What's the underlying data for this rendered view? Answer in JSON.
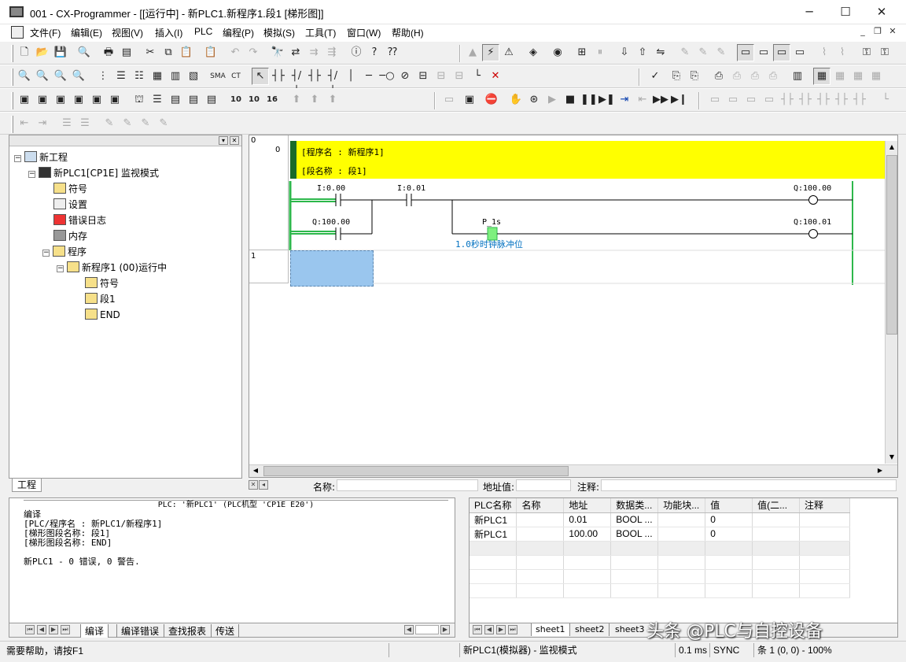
{
  "window": {
    "title": "001 - CX-Programmer - [[运行中] - 新PLC1.新程序1.段1 [梯形图]]",
    "minimize": "─",
    "maximize": "☐",
    "close": "✕"
  },
  "menu": [
    "文件(F)",
    "编辑(E)",
    "视图(V)",
    "插入(I)",
    "PLC",
    "编程(P)",
    "模拟(S)",
    "工具(T)",
    "窗口(W)",
    "帮助(H)"
  ],
  "project_tree": {
    "root": "新工程",
    "plc": "新PLC1[CP1E] 监视模式",
    "symbols": "符号",
    "settings": "设置",
    "error_log": "错误日志",
    "memory": "内存",
    "programs": "程序",
    "program1": "新程序1 (00)运行中",
    "prog_symbols": "符号",
    "section1": "段1",
    "end": "END",
    "tab": "工程"
  },
  "ladder": {
    "rung0_number": "0",
    "rung0_step": "0",
    "program_name": "[程序名 : 新程序1]",
    "section_name": "[段名称 : 段1]",
    "contact1": "I:0.00",
    "contact2": "I:0.01",
    "coil1": "Q:100.00",
    "contact3": "Q:100.00",
    "contact4": "P_1s",
    "contact4_comment": "1.0秒时钟脉冲位",
    "coil2": "Q:100.01",
    "rung1_number": "1",
    "status_name_label": "名称:",
    "status_addr_label": "地址值:",
    "status_comment_label": "注释:"
  },
  "output": {
    "header": "PLC: '新PLC1' (PLC机型 'CP1E E20')",
    "lines": [
      "编译",
      "[PLC/程序名 : 新PLC1/新程序1]",
      "[梯形图段名称: 段1]",
      "[梯形图段名称: END]",
      "",
      "新PLC1 - 0 错误, 0 警告."
    ],
    "tabs": [
      "编译",
      "编译错误",
      "查找报表",
      "传送"
    ]
  },
  "watch": {
    "columns": [
      "PLC名称",
      "名称",
      "地址",
      "数据类...",
      "功能块...",
      "值",
      "值(二...",
      "注释"
    ],
    "rows": [
      [
        "新PLC1",
        "",
        "0.01",
        "BOOL ...",
        "",
        "0",
        "",
        ""
      ],
      [
        "新PLC1",
        "",
        "100.00",
        "BOOL ...",
        "",
        "0",
        "",
        ""
      ]
    ],
    "sheets": [
      "sheet1",
      "sheet2",
      "sheet3"
    ]
  },
  "watermark": "头条 @PLC与自控设备",
  "statusbar": {
    "help": "需要帮助，请按F1",
    "plc_mode": "新PLC1(模拟器) - 监视模式",
    "cycle": "0.1 ms",
    "sync": "SYNC",
    "position": "条 1 (0, 0)  - 100%"
  },
  "colors": {
    "header_yellow": "#ffff00",
    "power_flow_green": "#2db84b",
    "selection_blue": "#9ac6ee",
    "comment_blue": "#0070c0"
  }
}
